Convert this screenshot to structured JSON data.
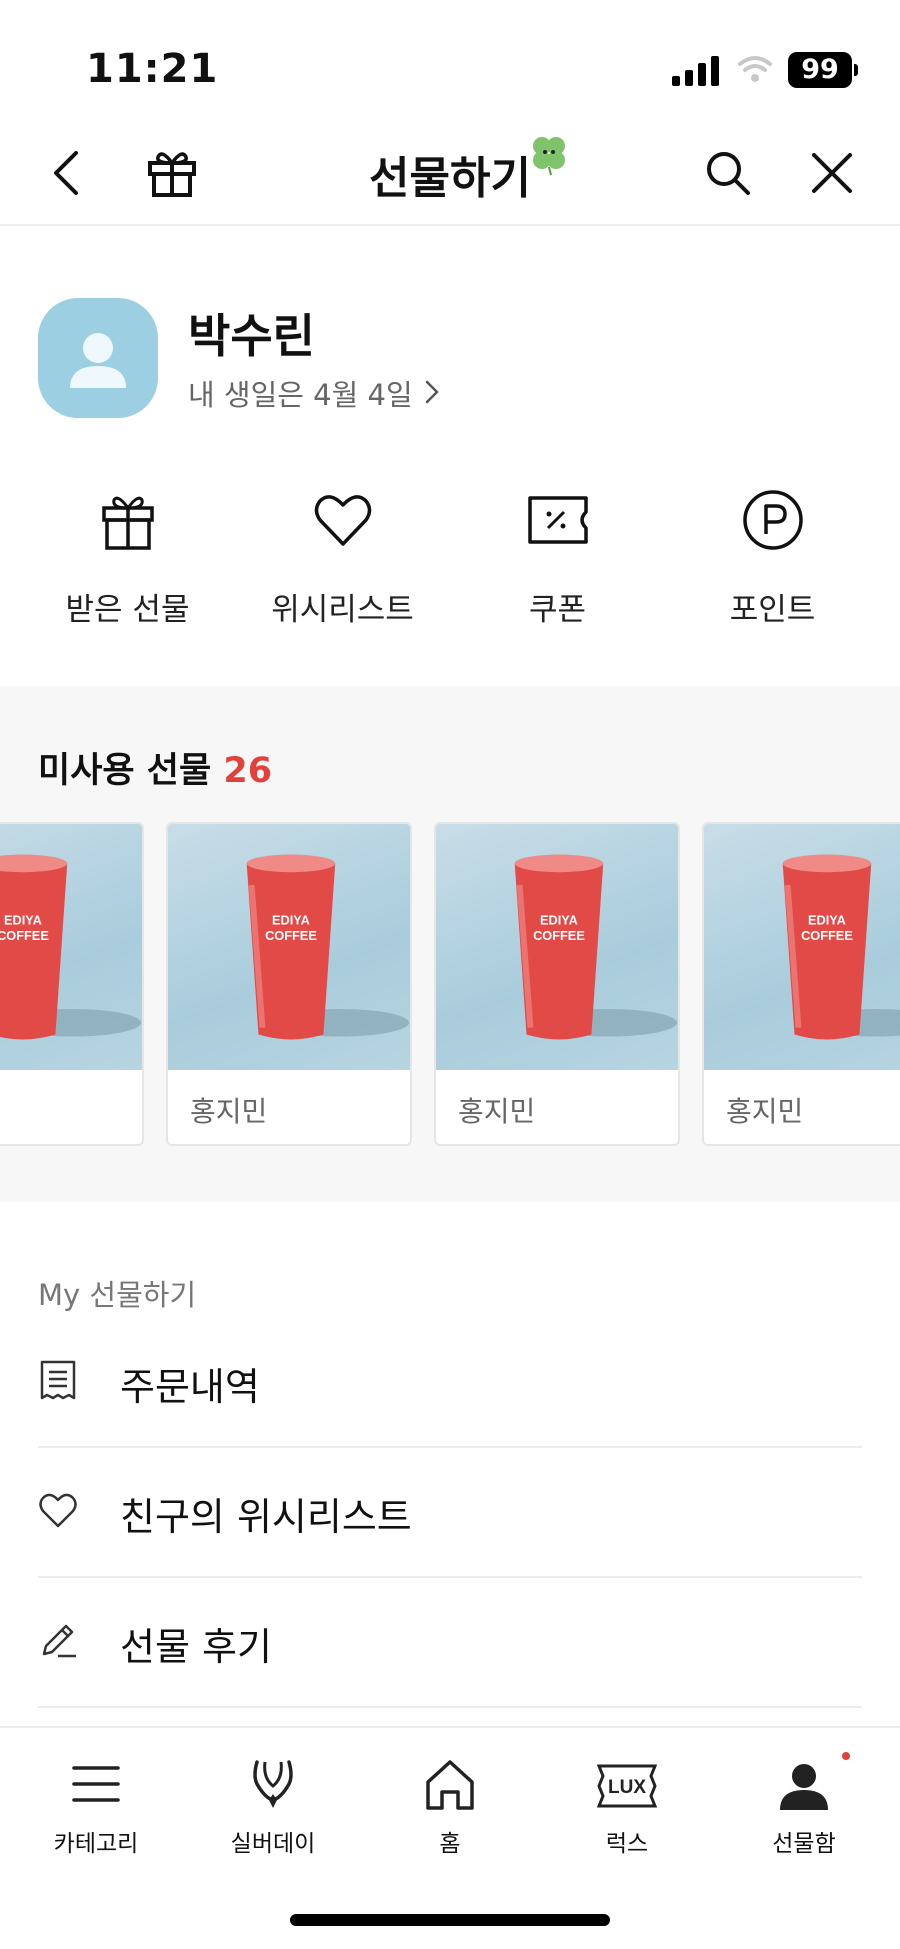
{
  "status_bar": {
    "time": "11:21",
    "battery": "99",
    "icons": [
      "cellular-signal-icon",
      "wifi-icon",
      "battery-icon"
    ]
  },
  "nav": {
    "title": "선물하기",
    "left_icons": [
      "back-chevron-icon",
      "gift-icon"
    ],
    "right_icons": [
      "search-icon",
      "close-icon"
    ],
    "decoration": "clover-icon"
  },
  "profile": {
    "name": "박수린",
    "birthday": "내 생일은 4월 4일",
    "avatar_color": "#9ccfe2"
  },
  "quick_menu": [
    {
      "label": "받은 선물",
      "icon": "gift-box-icon"
    },
    {
      "label": "위시리스트",
      "icon": "heart-icon"
    },
    {
      "label": "쿠폰",
      "icon": "coupon-icon"
    },
    {
      "label": "포인트",
      "icon": "point-icon"
    }
  ],
  "unused_gifts": {
    "title": "미사용 선물",
    "count": "26",
    "count_color": "#e2413b",
    "product_text": "EDIYA COFFEE",
    "product_line1": "EDIYA",
    "product_line2": "COFFEE",
    "cards": [
      {
        "sender": ""
      },
      {
        "sender": "홍지민"
      },
      {
        "sender": "홍지민"
      },
      {
        "sender": "홍지민"
      }
    ]
  },
  "my_menu": {
    "title": "My 선물하기",
    "items": [
      {
        "label": "주문내역",
        "icon": "receipt-icon"
      },
      {
        "label": "친구의 위시리스트",
        "icon": "heart-outline-icon"
      },
      {
        "label": "선물 후기",
        "icon": "pencil-icon"
      }
    ]
  },
  "tab_bar": {
    "tabs": [
      {
        "label": "카테고리",
        "icon": "menu-icon"
      },
      {
        "label": "실버데이",
        "icon": "necklace-icon"
      },
      {
        "label": "홈",
        "icon": "home-icon"
      },
      {
        "label": "럭스",
        "icon": "lux-icon",
        "icon_text": "LUX"
      },
      {
        "label": "선물함",
        "icon": "profile-icon"
      }
    ],
    "active_dot_color": "#e2413b"
  }
}
